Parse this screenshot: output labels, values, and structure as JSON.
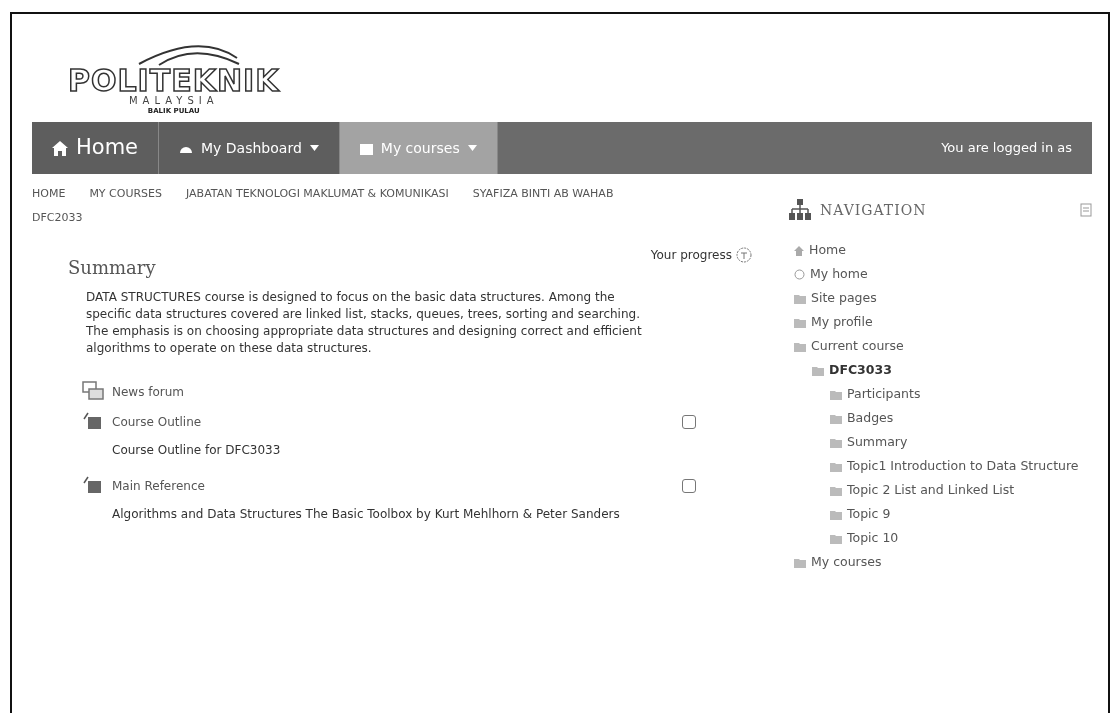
{
  "logo": {
    "name": "POLITEKNIK",
    "country": "MALAYSIA",
    "campus": "BALIK PULAU"
  },
  "navbar": {
    "items": [
      {
        "kind": "home",
        "label": "Home",
        "selected": false
      },
      {
        "kind": "dropdown",
        "label": "My Dashboard",
        "selected": false
      },
      {
        "kind": "dropdown",
        "label": "My courses",
        "selected": true
      }
    ],
    "login_text": "You are logged in as"
  },
  "breadcrumb": [
    "HOME",
    "MY COURSES",
    "JABATAN TEKNOLOGI MAKLUMAT & KOMUNIKASI",
    "SYAFIZA BINTI AB WAHAB",
    "DFC2033"
  ],
  "summary": {
    "title": "Summary",
    "progress_label": "Your progress",
    "text": "DATA STRUCTURES course is designed to focus on the basic data structures. Among the specific data structures covered are linked list, stacks, queues, trees, sorting and searching. The emphasis is on choosing appropriate data structures and designing correct and efficient algorithms to operate on these data structures."
  },
  "activities": [
    {
      "kind": "forum",
      "title": "News forum"
    },
    {
      "kind": "resource",
      "title": "Course Outline",
      "description": "Course Outline for DFC3033",
      "checked": false
    },
    {
      "kind": "resource",
      "title": "Main Reference",
      "description": "Algorithms and Data Structures The Basic Toolbox by Kurt Mehlhorn & Peter Sanders",
      "checked": false
    }
  ],
  "navigation": {
    "title": "NAVIGATION",
    "items": [
      {
        "label": "Home",
        "current": false,
        "kind": "home"
      },
      {
        "label": "My home",
        "current": false,
        "kind": "circle"
      },
      {
        "label": "Site pages",
        "current": false,
        "kind": "folder"
      },
      {
        "label": "My profile",
        "current": false,
        "kind": "folder"
      },
      {
        "label": "Current course",
        "current": false,
        "kind": "folder",
        "children": [
          {
            "label": "DFC3033",
            "current": true,
            "kind": "folder",
            "children": [
              {
                "label": "Participants",
                "current": false,
                "kind": "folder"
              },
              {
                "label": "Badges",
                "current": false,
                "kind": "folder"
              },
              {
                "label": "Summary",
                "current": false,
                "kind": "folder"
              },
              {
                "label": "Topic1 Introduction to Data Structure",
                "current": false,
                "kind": "folder"
              },
              {
                "label": "Topic 2 List and Linked List",
                "current": false,
                "kind": "folder"
              },
              {
                "label": "Topic 9",
                "current": false,
                "kind": "folder"
              },
              {
                "label": "Topic 10",
                "current": false,
                "kind": "folder"
              }
            ]
          }
        ]
      },
      {
        "label": "My courses",
        "current": false,
        "kind": "folder"
      }
    ]
  }
}
